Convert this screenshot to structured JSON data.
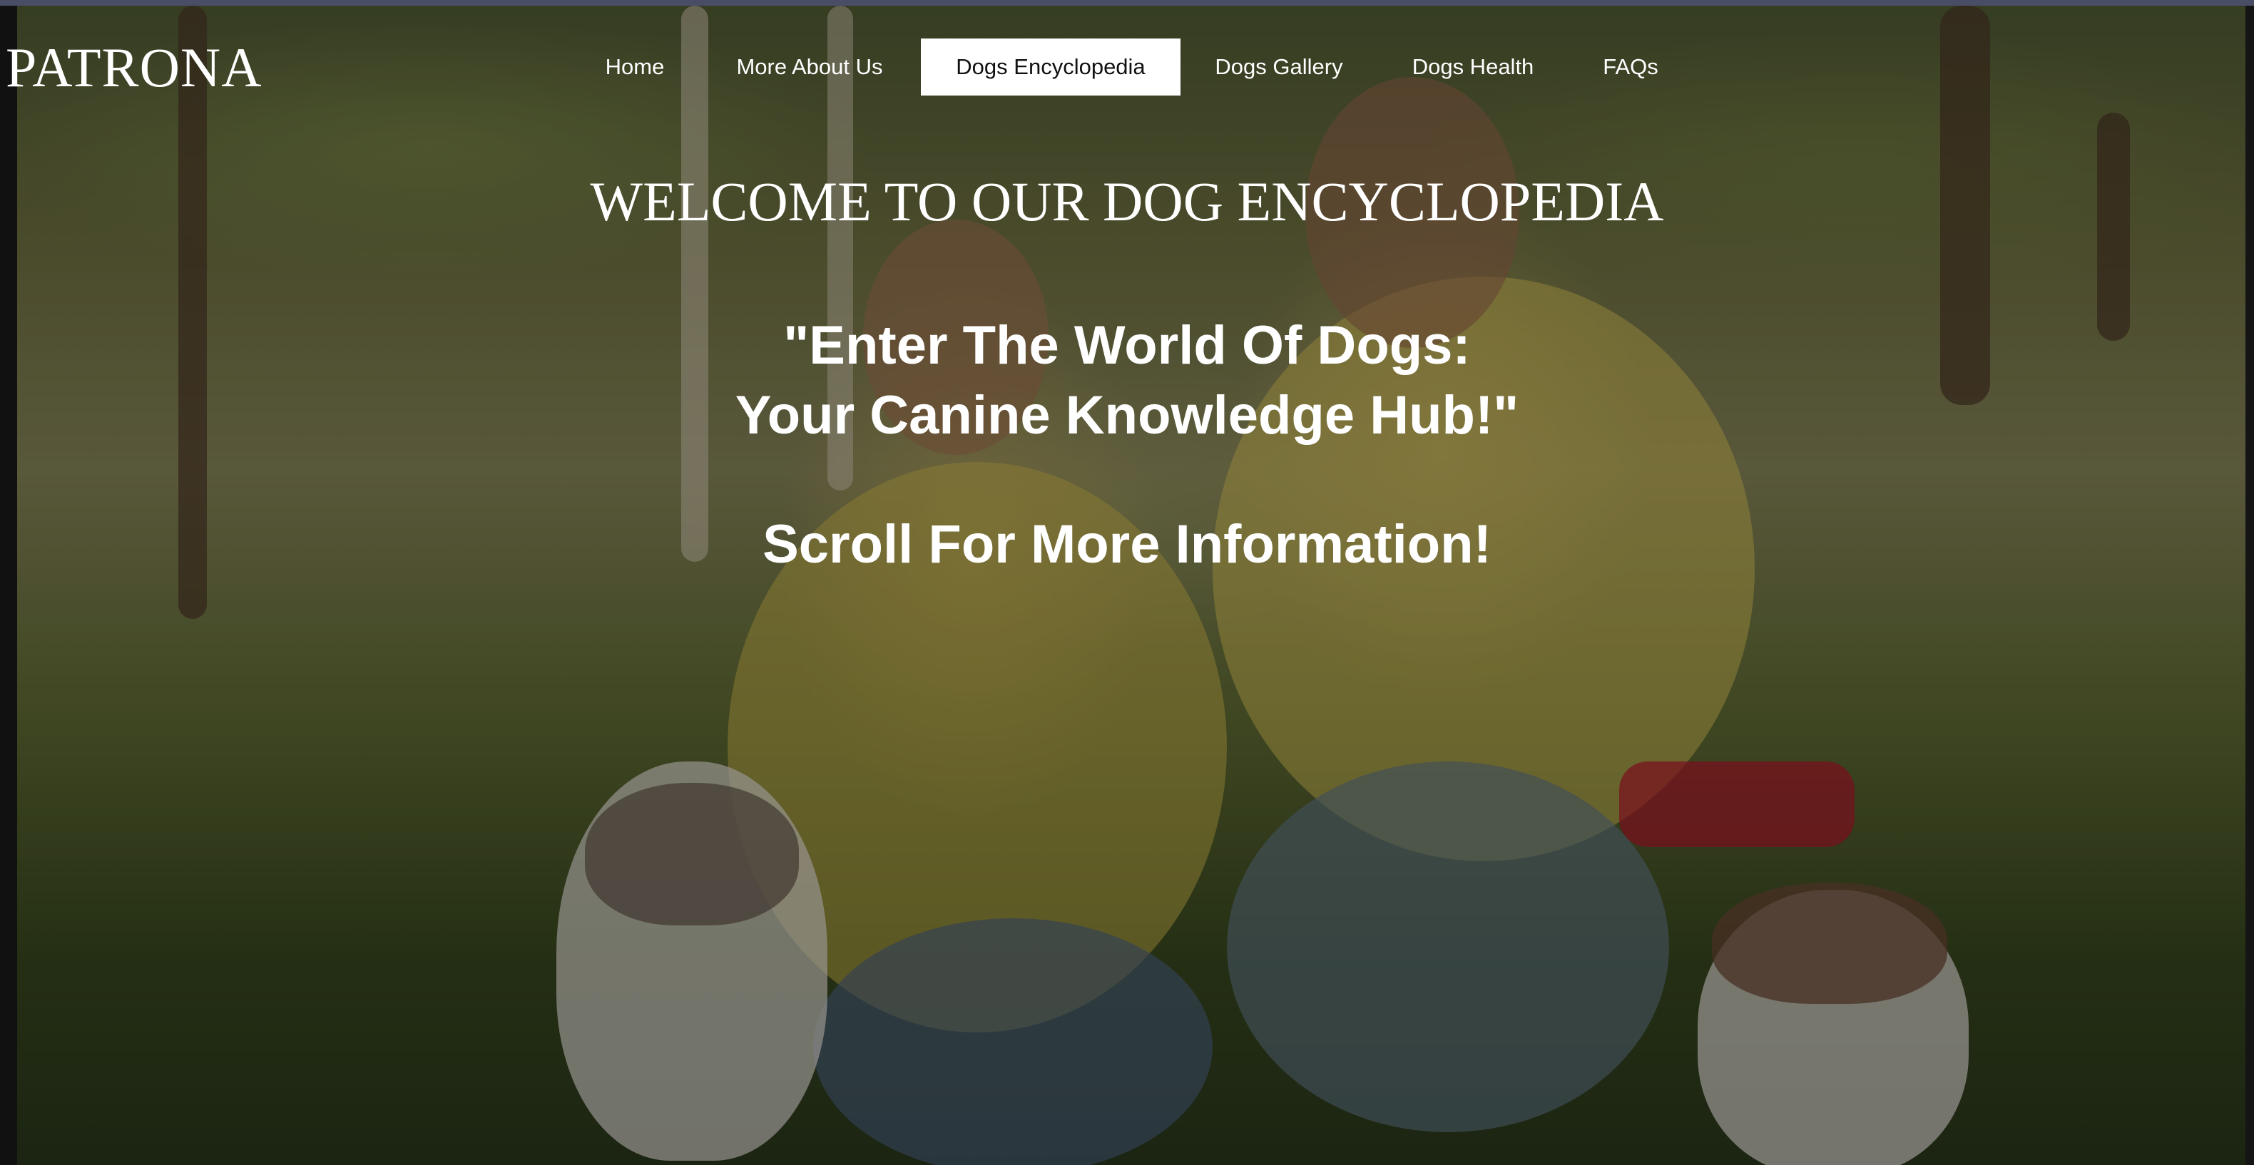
{
  "brand": {
    "logo": "PATRONA"
  },
  "nav": {
    "items": [
      {
        "label": "Home",
        "active": false
      },
      {
        "label": "More About Us",
        "active": false
      },
      {
        "label": "Dogs Encyclopedia",
        "active": true
      },
      {
        "label": "Dogs Gallery",
        "active": false
      },
      {
        "label": "Dogs Health",
        "active": false
      },
      {
        "label": "FAQs",
        "active": false
      }
    ]
  },
  "hero": {
    "headline": "WELCOME TO OUR DOG ENCYCLOPEDIA",
    "quote_line1": "\"Enter The World Of Dogs:",
    "quote_line2": "Your Canine Knowledge Hub!\"",
    "scroll_text": "Scroll For More Information!"
  },
  "colors": {
    "text": "#ffffff",
    "active_nav_bg": "#ffffff",
    "active_nav_text": "#111111"
  }
}
